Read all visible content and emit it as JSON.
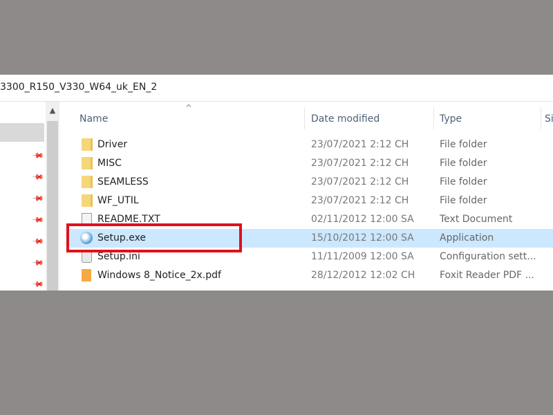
{
  "address": {
    "path": "3300_R150_V330_W64_uk_EN_2"
  },
  "columns": {
    "name": "Name",
    "date": "Date modified",
    "type": "Type",
    "size": "Si"
  },
  "colors": {
    "selection": "#cce8ff",
    "highlight_box": "#e0101e",
    "background": "#8f8a8a"
  },
  "files": [
    {
      "name": "Driver",
      "date": "23/07/2021 2:12 CH",
      "type": "File folder",
      "icon": "folder-icon"
    },
    {
      "name": "MISC",
      "date": "23/07/2021 2:12 CH",
      "type": "File folder",
      "icon": "folder-icon"
    },
    {
      "name": "SEAMLESS",
      "date": "23/07/2021 2:12 CH",
      "type": "File folder",
      "icon": "folder-icon"
    },
    {
      "name": "WF_UTIL",
      "date": "23/07/2021 2:12 CH",
      "type": "File folder",
      "icon": "folder-icon"
    },
    {
      "name": "README.TXT",
      "date": "02/11/2012 12:00 SA",
      "type": "Text Document",
      "icon": "text-file-icon"
    },
    {
      "name": "Setup.exe",
      "date": "15/10/2012 12:00 SA",
      "type": "Application",
      "icon": "setup-exe-icon",
      "selected": true
    },
    {
      "name": "Setup.ini",
      "date": "11/11/2009 12:00 SA",
      "type": "Configuration sett...",
      "icon": "config-file-icon"
    },
    {
      "name": "Windows 8_Notice_2x.pdf",
      "date": "28/12/2012 12:02 CH",
      "type": "Foxit Reader PDF ...",
      "icon": "pdf-file-icon"
    }
  ]
}
